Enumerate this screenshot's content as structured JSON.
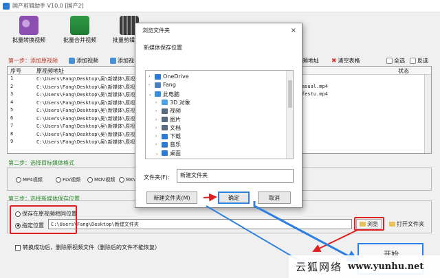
{
  "window": {
    "title": "国产剪辑助手 V10.0   [国产2]"
  },
  "toolbar": [
    {
      "label": "批量转换视频",
      "color": "#8a4fb0"
    },
    {
      "label": "批量合并视频",
      "color": "#2f9a43"
    },
    {
      "label": "批量剪辑视频",
      "color": "#3a3a3a"
    }
  ],
  "step1": {
    "label": "第一步：添加原视频",
    "add_video": "添加视频",
    "add_folder_partial": "添加视",
    "clear_list": "清空表格",
    "select_all": "全选",
    "invert": "反选",
    "address_partial": "频地址"
  },
  "table": {
    "columns": {
      "index": "序号",
      "path": "原视频地址",
      "status": "状态"
    },
    "rows": [
      {
        "n": "1",
        "path": "C:\\Users\\Fang\\Desktop\\吴\\新媒体\\原视频\\",
        "tail": ""
      },
      {
        "n": "2",
        "path": "C:\\Users\\Fang\\Desktop\\吴\\新媒体\\原视频\\",
        "tail": "asual.mp4"
      },
      {
        "n": "3",
        "path": "C:\\Users\\Fang\\Desktop\\吴\\新媒体\\原视频\\",
        "tail": "  festu.mp4"
      },
      {
        "n": "4",
        "path": "C:\\Users\\Fang\\Desktop\\吴\\新媒体\\原视频\\",
        "tail": ""
      },
      {
        "n": "5",
        "path": "C:\\Users\\Fang\\Desktop\\吴\\新媒体\\原视频\\",
        "tail": ""
      },
      {
        "n": "6",
        "path": "C:\\Users\\Fang\\Desktop\\吴\\新媒体\\原视频\\",
        "tail": ""
      },
      {
        "n": "7",
        "path": "C:\\Users\\Fang\\Desktop\\吴\\新媒体\\原视频\\",
        "tail": ""
      },
      {
        "n": "8",
        "path": "C:\\Users\\Fang\\Desktop\\吴\\新媒体\\原视频\\",
        "tail": ""
      },
      {
        "n": "9",
        "path": "C:\\Users\\Fang\\Desktop\\吴\\新媒体\\原视频\\",
        "tail": ""
      }
    ]
  },
  "step2": {
    "label": "第二步：选择目标媒体格式",
    "formats": [
      "MP4视频",
      "FLV视频",
      "MOV视频",
      "MKV视"
    ]
  },
  "step3": {
    "label": "第三步：选择新媒体保存位置",
    "same_location": "保存在原视频相同位置",
    "custom_location": "指定位置",
    "path_value": "C:\\Users\\Fang\\Desktop\\新建文件夹",
    "browse": "浏览",
    "open_folder": "打开文件夹"
  },
  "options": {
    "delete_original": "转换成功后，删除原视频文件（删除后的文件不能恢复）"
  },
  "start": {
    "label": "开始"
  },
  "dialog": {
    "title": "浏览文件夹",
    "close": "×",
    "subtitle": "新媒体保存位置",
    "tree": [
      {
        "label": "OneDrive",
        "icon": "cloud-icon",
        "color": "#2b7bd6"
      },
      {
        "label": "Fang",
        "icon": "user-icon",
        "color": "#4a7fc1"
      },
      {
        "label": "此电脑",
        "icon": "computer-icon",
        "color": "#3a8ee0"
      },
      {
        "label": "3D 对象",
        "icon": "cube-icon",
        "color": "#4aa3e8"
      },
      {
        "label": "视频",
        "icon": "video-icon",
        "color": "#5a6b80"
      },
      {
        "label": "图片",
        "icon": "image-icon",
        "color": "#5a6b80"
      },
      {
        "label": "文档",
        "icon": "document-icon",
        "color": "#5a6b80"
      },
      {
        "label": "下载",
        "icon": "download-icon",
        "color": "#2b7bd6"
      },
      {
        "label": "音乐",
        "icon": "music-icon",
        "color": "#2b7bd6"
      },
      {
        "label": "桌面",
        "icon": "desktop-icon",
        "color": "#2b7bd6"
      }
    ],
    "folder_label": "文件夹(F):",
    "folder_value": "新建文件夹",
    "new_folder": "新建文件夹(M)",
    "ok": "确定",
    "cancel": "取消"
  },
  "watermark": {
    "brand": "云狐网络",
    "url": "www.yunhu.net"
  },
  "colors": {
    "annotation_red": "#e02020",
    "annotation_blue": "#2b80e0",
    "step_green": "#2a8a2a",
    "step_red": "#c0392b"
  }
}
